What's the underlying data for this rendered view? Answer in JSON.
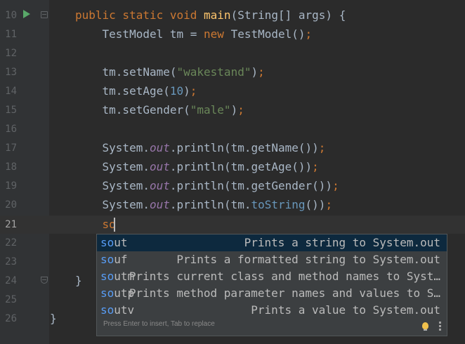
{
  "editor": {
    "lines": [
      {
        "no": "10",
        "segments": [
          [
            "",
            ""
          ]
        ]
      },
      {
        "no": "11"
      },
      {
        "no": "12"
      },
      {
        "no": "13"
      },
      {
        "no": "14"
      },
      {
        "no": "15"
      },
      {
        "no": "16"
      },
      {
        "no": "17"
      },
      {
        "no": "18"
      },
      {
        "no": "19"
      },
      {
        "no": "20"
      },
      {
        "no": "21"
      },
      {
        "no": "22"
      },
      {
        "no": "23"
      },
      {
        "no": "24"
      },
      {
        "no": "25"
      },
      {
        "no": "26"
      }
    ],
    "code": {
      "l10_kw": "public static void ",
      "l10_fn": "main",
      "l10_rest": "(String[] args) {",
      "l11_a": "    TestModel tm = ",
      "l11_kw": "new",
      "l11_b": " TestModel()",
      "l11_semi": ";",
      "l13_a": "    tm.setName(",
      "l13_str": "\"wakestand\"",
      "l13_b": ")",
      "l13_semi": ";",
      "l14_a": "    tm.setAge(",
      "l14_num": "10",
      "l14_b": ")",
      "l14_semi": ";",
      "l15_a": "    tm.setGender(",
      "l15_str": "\"male\"",
      "l15_b": ")",
      "l15_semi": ";",
      "l17_a": "    System.",
      "l17_fld": "out",
      "l17_b": ".println(tm.getName())",
      "l17_semi": ";",
      "l18_a": "    System.",
      "l18_fld": "out",
      "l18_b": ".println(tm.getAge())",
      "l18_semi": ";",
      "l19_a": "    System.",
      "l19_fld": "out",
      "l19_b": ".println(tm.getGender())",
      "l19_semi": ";",
      "l20_a": "    System.",
      "l20_fld": "out",
      "l20_b": ".println(tm.",
      "l20_c": "toString",
      "l20_d": "())",
      "l20_semi": ";",
      "l21_typed": "    so",
      "l24_brace": "}",
      "l26_brace": "}"
    }
  },
  "completion": {
    "items": [
      {
        "prefix": "so",
        "suffix": "ut",
        "desc": "Prints a string to System.out"
      },
      {
        "prefix": "so",
        "suffix": "uf",
        "desc": "Prints a formatted string to System.out"
      },
      {
        "prefix": "so",
        "suffix": "utm",
        "desc": "Prints current class and method names to Syst…"
      },
      {
        "prefix": "so",
        "suffix": "utp",
        "desc": "Prints method parameter names and values to S…"
      },
      {
        "prefix": "so",
        "suffix": "utv",
        "desc": "Prints a value to System.out"
      }
    ],
    "hint": "Press Enter to insert, Tab to replace"
  },
  "colors": {
    "background": "#2b2b2b",
    "keyword": "#cc7832",
    "string": "#6a8759",
    "number": "#6897bb",
    "selection": "#0d293e",
    "match": "#589df6"
  }
}
